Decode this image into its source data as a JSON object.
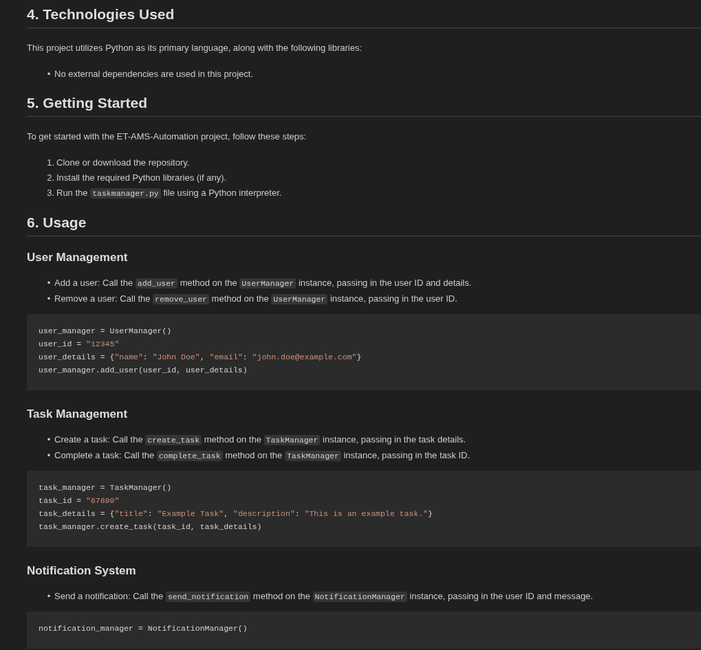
{
  "blocks": [
    {
      "kind": "h2",
      "text": "4. Technologies Used"
    },
    {
      "kind": "p",
      "parts": [
        {
          "kind": "text",
          "text": "This project utilizes Python as its primary language, along with the following libraries:"
        }
      ]
    },
    {
      "kind": "ul",
      "items": [
        {
          "marker": "•",
          "parts": [
            {
              "kind": "text",
              "text": "No external dependencies are used in this project."
            }
          ]
        }
      ]
    },
    {
      "kind": "h2",
      "text": "5. Getting Started"
    },
    {
      "kind": "p",
      "parts": [
        {
          "kind": "text",
          "text": "To get started with the ET-AMS-Automation project, follow these steps:"
        }
      ]
    },
    {
      "kind": "ol",
      "items": [
        {
          "marker": "1.",
          "parts": [
            {
              "kind": "text",
              "text": "Clone or download the repository."
            }
          ]
        },
        {
          "marker": "2.",
          "parts": [
            {
              "kind": "text",
              "text": "Install the required Python libraries (if any)."
            }
          ]
        },
        {
          "marker": "3.",
          "parts": [
            {
              "kind": "text",
              "text": "Run the "
            },
            {
              "kind": "code",
              "text": "taskmanager.py"
            },
            {
              "kind": "text",
              "text": " file using a Python interpreter."
            }
          ]
        }
      ]
    },
    {
      "kind": "h2",
      "text": "6. Usage"
    },
    {
      "kind": "h3",
      "text": "User Management"
    },
    {
      "kind": "ul",
      "items": [
        {
          "marker": "•",
          "parts": [
            {
              "kind": "text",
              "text": "Add a user: Call the "
            },
            {
              "kind": "code",
              "text": "add_user"
            },
            {
              "kind": "text",
              "text": " method on the "
            },
            {
              "kind": "code",
              "text": "UserManager"
            },
            {
              "kind": "text",
              "text": " instance, passing in the user ID and details."
            }
          ]
        },
        {
          "marker": "•",
          "parts": [
            {
              "kind": "text",
              "text": "Remove a user: Call the "
            },
            {
              "kind": "code",
              "text": "remove_user"
            },
            {
              "kind": "text",
              "text": " method on the "
            },
            {
              "kind": "code",
              "text": "UserManager"
            },
            {
              "kind": "text",
              "text": " instance, passing in the user ID."
            }
          ]
        }
      ]
    },
    {
      "kind": "code",
      "lines": [
        [
          {
            "kind": "plain",
            "text": "user_manager = UserManager()"
          }
        ],
        [
          {
            "kind": "plain",
            "text": "user_id = "
          },
          {
            "kind": "string",
            "text": "\"12345\""
          }
        ],
        [
          {
            "kind": "plain",
            "text": "user_details = {"
          },
          {
            "kind": "string",
            "text": "\"name\""
          },
          {
            "kind": "plain",
            "text": ": "
          },
          {
            "kind": "string",
            "text": "\"John Doe\""
          },
          {
            "kind": "plain",
            "text": ", "
          },
          {
            "kind": "string",
            "text": "\"email\""
          },
          {
            "kind": "plain",
            "text": ": "
          },
          {
            "kind": "string",
            "text": "\"john.doe@example.com\""
          },
          {
            "kind": "plain",
            "text": "}"
          }
        ],
        [
          {
            "kind": "plain",
            "text": "user_manager.add_user(user_id, user_details)"
          }
        ]
      ]
    },
    {
      "kind": "h3",
      "text": "Task Management"
    },
    {
      "kind": "ul",
      "items": [
        {
          "marker": "•",
          "parts": [
            {
              "kind": "text",
              "text": "Create a task: Call the "
            },
            {
              "kind": "code",
              "text": "create_task"
            },
            {
              "kind": "text",
              "text": " method on the "
            },
            {
              "kind": "code",
              "text": "TaskManager"
            },
            {
              "kind": "text",
              "text": " instance, passing in the task details."
            }
          ]
        },
        {
          "marker": "•",
          "parts": [
            {
              "kind": "text",
              "text": "Complete a task: Call the "
            },
            {
              "kind": "code",
              "text": "complete_task"
            },
            {
              "kind": "text",
              "text": " method on the "
            },
            {
              "kind": "code",
              "text": "TaskManager"
            },
            {
              "kind": "text",
              "text": " instance, passing in the task ID."
            }
          ]
        }
      ]
    },
    {
      "kind": "code",
      "lines": [
        [
          {
            "kind": "plain",
            "text": "task_manager = TaskManager()"
          }
        ],
        [
          {
            "kind": "plain",
            "text": "task_id = "
          },
          {
            "kind": "string",
            "text": "\"67890\""
          }
        ],
        [
          {
            "kind": "plain",
            "text": "task_details = {"
          },
          {
            "kind": "string",
            "text": "\"title\""
          },
          {
            "kind": "plain",
            "text": ": "
          },
          {
            "kind": "string",
            "text": "\"Example Task\""
          },
          {
            "kind": "plain",
            "text": ", "
          },
          {
            "kind": "string",
            "text": "\"description\""
          },
          {
            "kind": "plain",
            "text": ": "
          },
          {
            "kind": "string",
            "text": "\"This is an example task.\""
          },
          {
            "kind": "plain",
            "text": "}"
          }
        ],
        [
          {
            "kind": "plain",
            "text": "task_manager.create_task(task_id, task_details)"
          }
        ]
      ]
    },
    {
      "kind": "h3",
      "text": "Notification System"
    },
    {
      "kind": "ul",
      "items": [
        {
          "marker": "•",
          "parts": [
            {
              "kind": "text",
              "text": "Send a notification: Call the "
            },
            {
              "kind": "code",
              "text": "send_notification"
            },
            {
              "kind": "text",
              "text": " method on the "
            },
            {
              "kind": "code",
              "text": "NotificationManager"
            },
            {
              "kind": "text",
              "text": " instance, passing in the user ID and message."
            }
          ]
        }
      ]
    },
    {
      "kind": "code",
      "lines": [
        [
          {
            "kind": "plain",
            "text": "notification_manager = NotificationManager()"
          }
        ]
      ]
    }
  ]
}
